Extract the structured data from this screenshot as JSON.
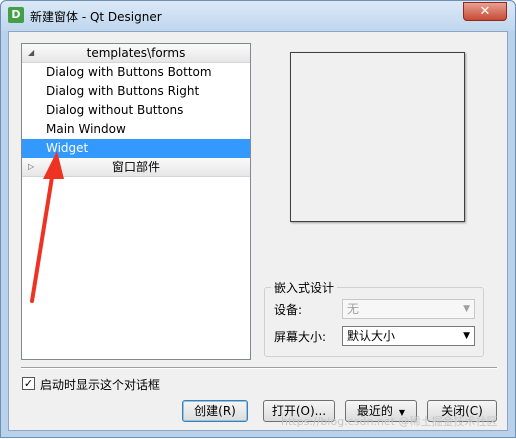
{
  "window": {
    "icon_letter": "D",
    "title": "新建窗体 - Qt Designer",
    "close_glyph": "x"
  },
  "tree": {
    "groups": [
      {
        "label": "templates\\forms",
        "expanded": true,
        "items": [
          {
            "label": "Dialog with Buttons Bottom",
            "selected": false
          },
          {
            "label": "Dialog with Buttons Right",
            "selected": false
          },
          {
            "label": "Dialog without Buttons",
            "selected": false
          },
          {
            "label": "Main Window",
            "selected": false
          },
          {
            "label": "Widget",
            "selected": true
          }
        ]
      },
      {
        "label": "窗口部件",
        "expanded": false,
        "items": []
      }
    ]
  },
  "embedded": {
    "title": "嵌入式设计",
    "device_label": "设备:",
    "device_value": "无",
    "screen_size_label": "屏幕大小:",
    "screen_size_value": "默认大小"
  },
  "startup": {
    "checked": true,
    "label": "启动时显示这个对话框"
  },
  "buttons": {
    "create": "创建(R)",
    "open": "打开(O)...",
    "recent": "最近的",
    "close": "关闭(C)"
  },
  "watermark": "https://blog.csdn.net @稀土掘金技术社区",
  "colors": {
    "selection": "#3399ff",
    "annotation_arrow": "#ee3322"
  }
}
